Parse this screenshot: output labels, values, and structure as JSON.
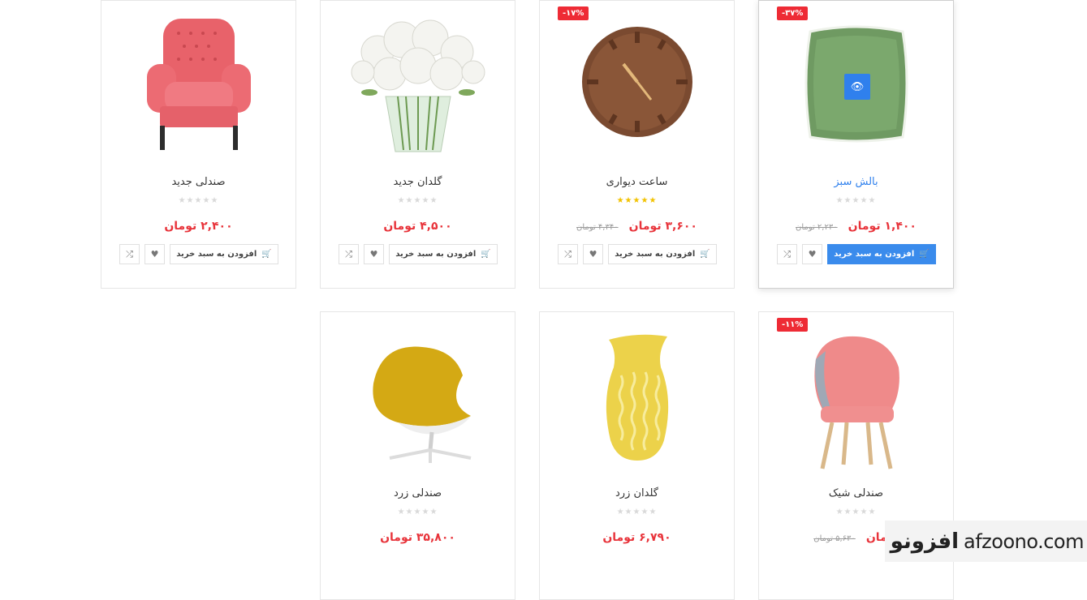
{
  "actions": {
    "add_to_cart": "افزودن به سبد خرید",
    "compare_icon": "shuffle-icon",
    "wishlist_icon": "heart-icon",
    "cart_icon": "cart-icon"
  },
  "colors": {
    "badge": "#ee2b35",
    "price": "#e8343b",
    "accent": "#3a8bec",
    "star_filled": "#f2c200",
    "star_empty": "#d9d9d9"
  },
  "products": [
    {
      "title": "صندلی جدید",
      "price": "۲,۴۰۰ تومان",
      "old_price": "",
      "badge": "",
      "rating": 0
    },
    {
      "title": "گلدان جدید",
      "price": "۴,۵۰۰ تومان",
      "old_price": "",
      "badge": "",
      "rating": 0
    },
    {
      "title": "ساعت دیواری",
      "price": "۳,۶۰۰ تومان",
      "old_price": "۴,۳۴۰ تومان",
      "badge": "-۱۷%",
      "rating": 5
    },
    {
      "title": "بالش سبز",
      "price": "۱,۴۰۰ تومان",
      "old_price": "۲,۲۳۰ تومان",
      "badge": "-۳۷%",
      "rating": 0
    },
    {
      "title": "صندلی زرد",
      "price": "۳۵,۸۰۰ تومان",
      "old_price": "",
      "badge": "",
      "rating": 0
    },
    {
      "title": "گلدان زرد",
      "price": "۶,۷۹۰ تومان",
      "old_price": "",
      "badge": "",
      "rating": 0
    },
    {
      "title": "صندلی شیک",
      "price": "تومان",
      "old_price": "۵,۶۳۰ تومان",
      "badge": "-۱۱%",
      "rating": 0
    }
  ],
  "watermark": {
    "url": "afzoono.com",
    "logo": "افزونو"
  }
}
